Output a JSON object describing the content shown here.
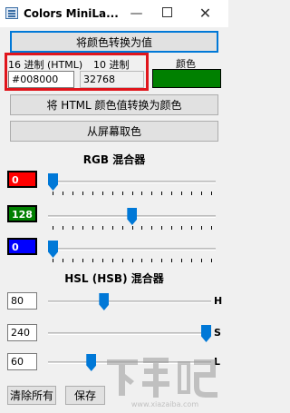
{
  "window": {
    "title": "Colors MiniLa...",
    "minimize": "—",
    "close": "✕"
  },
  "toolbar": {
    "convert_color_button": "将颜色转换为值",
    "html_to_color_button": "将 HTML 颜色值转换为颜色",
    "pick_screen_button": "从屏幕取色"
  },
  "values": {
    "hex_label": "16 进制 (HTML)",
    "decimal_label": "10 进制",
    "color_label": "颜色",
    "hex_value": "#008000",
    "decimal_value": "32768",
    "color": "#008000"
  },
  "rgb_mixer": {
    "title": "RGB 混合器",
    "red": 0,
    "green": 128,
    "blue": 0,
    "max": 255
  },
  "hsl_mixer": {
    "title": "HSL (HSB) 混合器",
    "h": 80,
    "s": 240,
    "l": 60,
    "h_label": "H",
    "s_label": "S",
    "l_label": "L",
    "max": 240
  },
  "footer": {
    "clear_all_button": "清除所有",
    "save_button": "保存"
  },
  "watermark": "下载吧 www.xiazaiba.com"
}
